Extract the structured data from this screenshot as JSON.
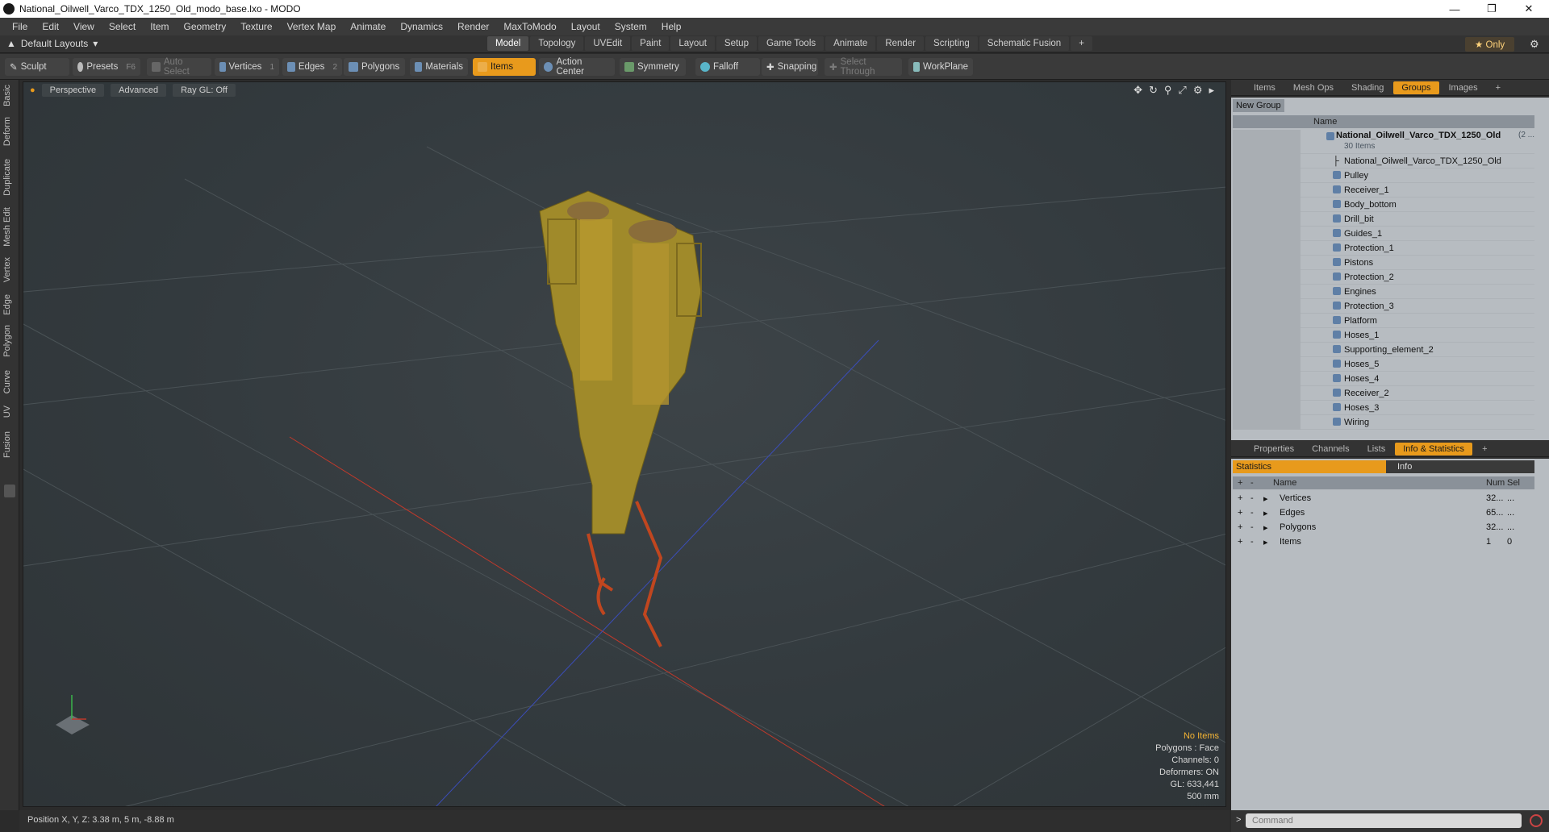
{
  "window": {
    "title": "National_Oilwell_Varco_TDX_1250_Old_modo_base.lxo - MODO"
  },
  "menu": [
    "File",
    "Edit",
    "View",
    "Select",
    "Item",
    "Geometry",
    "Texture",
    "Vertex Map",
    "Animate",
    "Dynamics",
    "Render",
    "MaxToModo",
    "Layout",
    "System",
    "Help"
  ],
  "layout": {
    "current": "Default Layouts",
    "tabs": [
      "Model",
      "Topology",
      "UVEdit",
      "Paint",
      "Layout",
      "Setup",
      "Game Tools",
      "Animate",
      "Render",
      "Scripting",
      "Schematic Fusion"
    ],
    "active_tab": "Model",
    "only_label": "Only"
  },
  "toolbar": {
    "sculpt": "Sculpt",
    "presets": "Presets",
    "presets_key": "F6",
    "auto_select": "Auto Select",
    "vertices": "Vertices",
    "vertices_key": "1",
    "edges": "Edges",
    "edges_key": "2",
    "polygons": "Polygons",
    "materials": "Materials",
    "items": "Items",
    "action_center": "Action Center",
    "symmetry": "Symmetry",
    "falloff": "Falloff",
    "snapping": "Snapping",
    "select_through": "Select Through",
    "workplane": "WorkPlane"
  },
  "left_tabs": [
    "Basic",
    "Deform",
    "Duplicate",
    "Mesh Edit",
    "Vertex",
    "Edge",
    "Polygon",
    "Curve",
    "UV",
    "Fusion"
  ],
  "viewport": {
    "view": "Perspective",
    "shading": "Advanced",
    "raygl": "Ray GL: Off",
    "info": {
      "no_items": "No Items",
      "polygons": "Polygons : Face",
      "channels": "Channels: 0",
      "deformers": "Deformers: ON",
      "gl": "GL: 633,441",
      "scale": "500 mm"
    }
  },
  "groups_panel": {
    "tabs": [
      "Items",
      "Mesh Ops",
      "Shading",
      "Groups",
      "Images"
    ],
    "active_tab": "Groups",
    "new_group": "New Group",
    "name_header": "Name",
    "root": {
      "name": "National_Oilwell_Varco_TDX_1250_Old",
      "suffix": "(2 ...",
      "count": "30 Items"
    },
    "items": [
      "National_Oilwell_Varco_TDX_1250_Old",
      "Pulley",
      "Receiver_1",
      "Body_bottom",
      "Drill_bit",
      "Guides_1",
      "Protection_1",
      "Pistons",
      "Protection_2",
      "Engines",
      "Protection_3",
      "Platform",
      "Hoses_1",
      "Supporting_element_2",
      "Hoses_5",
      "Hoses_4",
      "Receiver_2",
      "Hoses_3",
      "Wiring"
    ]
  },
  "stats_panel": {
    "tabs": [
      "Properties",
      "Channels",
      "Lists",
      "Info & Statistics"
    ],
    "active_tab": "Info & Statistics",
    "sub_tabs": [
      "Statistics",
      "Info"
    ],
    "headers": {
      "name": "Name",
      "num": "Num",
      "sel": "Sel"
    },
    "rows": [
      {
        "name": "Vertices",
        "num": "32...",
        "sel": "..."
      },
      {
        "name": "Edges",
        "num": "65...",
        "sel": "..."
      },
      {
        "name": "Polygons",
        "num": "32...",
        "sel": "..."
      },
      {
        "name": "Items",
        "num": "1",
        "sel": "0"
      }
    ]
  },
  "command": {
    "placeholder": "Command"
  },
  "status": {
    "position": "Position X, Y, Z:  3.38 m, 5 m, -8.88 m"
  }
}
